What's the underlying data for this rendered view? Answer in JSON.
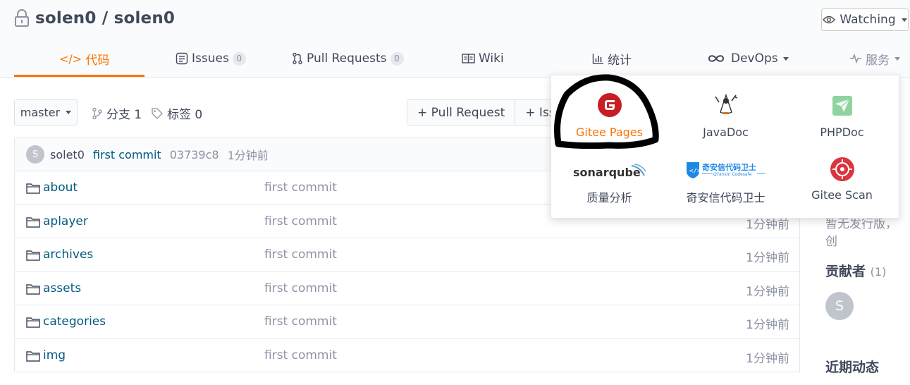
{
  "repo": {
    "owner": "solen0",
    "separator": "/",
    "name": "solen0",
    "full": "solen0 / solen0"
  },
  "watch": {
    "label": "Watching"
  },
  "tabs": [
    {
      "label": "代码",
      "icon": "code-icon",
      "active": true
    },
    {
      "label": "Issues",
      "icon": "issues-icon",
      "count": "0"
    },
    {
      "label": "Pull Requests",
      "icon": "pull-request-icon",
      "count": "0"
    },
    {
      "label": "Wiki",
      "icon": "wiki-icon"
    },
    {
      "label": "统计",
      "icon": "stats-icon"
    },
    {
      "label": "DevOps",
      "icon": "devops-icon"
    },
    {
      "label": "服务",
      "icon": "services-icon"
    }
  ],
  "branch": {
    "current": "master",
    "branches_label": "分支 1",
    "tags_label": "标签 0"
  },
  "actions": {
    "pull_request": "+ Pull Request",
    "issue": "+ Issue"
  },
  "last_commit": {
    "avatar": "S",
    "author": "solet0",
    "message": "first commit",
    "hash": "03739c8",
    "time": "1分钟前"
  },
  "files": [
    {
      "name": "about",
      "message": "first commit",
      "time": ""
    },
    {
      "name": "aplayer",
      "message": "first commit",
      "time": "1分钟前"
    },
    {
      "name": "archives",
      "message": "first commit",
      "time": "1分钟前"
    },
    {
      "name": "assets",
      "message": "first commit",
      "time": "1分钟前"
    },
    {
      "name": "categories",
      "message": "first commit",
      "time": "1分钟前"
    },
    {
      "name": "img",
      "message": "first commit",
      "time": "1分钟前"
    }
  ],
  "sidebar": {
    "cut_text": "暂无发行版，  创",
    "contributors_title": "贡献者",
    "contributors_count": "(1)",
    "contributor_avatar": "S",
    "activity_title": "近期动态"
  },
  "services": [
    {
      "label": "Gitee Pages",
      "icon": "gitee-pages-icon",
      "highlight": true
    },
    {
      "label": "JavaDoc",
      "icon": "javadoc-icon"
    },
    {
      "label": "PHPDoc",
      "icon": "phpdoc-icon"
    },
    {
      "label": "质量分析",
      "icon": "sonarqube-logo",
      "logo_text": "sonarqube"
    },
    {
      "label": "奇安信代码卫士",
      "icon": "qianxin-codesafe-logo",
      "logo_text": "奇安信代码卫士",
      "logo_sub": "Qi'anxin Codesafe"
    },
    {
      "label": "Gitee Scan",
      "icon": "gitee-scan-icon"
    }
  ],
  "colors": {
    "accent": "#fe7300",
    "link": "#005980",
    "muted": "#8c92a4",
    "annotation": "#000000"
  }
}
